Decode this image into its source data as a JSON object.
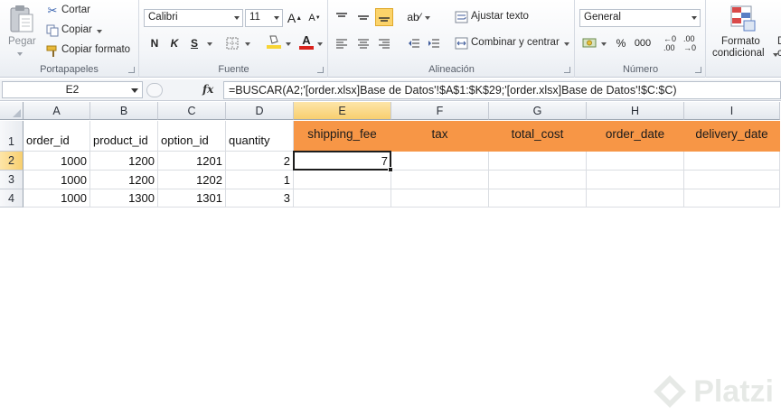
{
  "ribbon": {
    "clipboard": {
      "paste_label": "Pegar",
      "cut_label": "Cortar",
      "copy_label": "Copiar",
      "copy_format_label": "Copiar formato",
      "group_label": "Portapapeles"
    },
    "font": {
      "font_name": "Calibri",
      "font_size": "11",
      "bold": "N",
      "italic": "K",
      "underline": "S",
      "group_label": "Fuente",
      "font_color": "#d9221c",
      "fill_color": "#f7d435"
    },
    "alignment": {
      "wrap_text_label": "Ajustar texto",
      "merge_center_label": "Combinar y centrar",
      "group_label": "Alineación"
    },
    "number": {
      "format_value": "General",
      "percent": "%",
      "thousands": "000",
      "group_label": "Número"
    },
    "styles": {
      "conditional_format_line1": "Formato",
      "conditional_format_line2": "condicional",
      "cut_off_label_1": "D",
      "cut_off_label_2": "c"
    }
  },
  "formula_bar": {
    "name_box": "E2",
    "fx_label": "fx",
    "formula": "=BUSCAR(A2;'[order.xlsx]Base de Datos'!$A$1:$K$29;'[order.xlsx]Base de Datos'!$C:$C)"
  },
  "sheet": {
    "columns": [
      "A",
      "B",
      "C",
      "D",
      "E",
      "F",
      "G",
      "H",
      "I"
    ],
    "rows": [
      "1",
      "2",
      "3",
      "4"
    ],
    "headers": [
      "order_id",
      "product_id",
      "option_id",
      "quantity",
      "shipping_fee",
      "tax",
      "total_cost",
      "order_date",
      "delivery_date"
    ],
    "data": [
      [
        "1000",
        "1200",
        "1201",
        "2",
        "7"
      ],
      [
        "1000",
        "1200",
        "1202",
        "1",
        ""
      ],
      [
        "1000",
        "1300",
        "1301",
        "3",
        ""
      ]
    ],
    "header_fill": "#f79646",
    "selection_color": "#f8cf6f"
  },
  "watermark": {
    "text": "Platzi"
  }
}
